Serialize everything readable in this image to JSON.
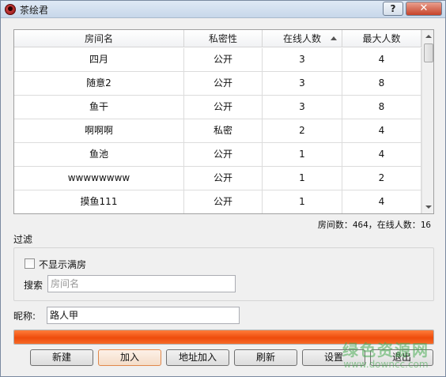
{
  "window": {
    "title": "茶绘君",
    "help_label": "?",
    "close_label": "✕"
  },
  "table": {
    "columns": [
      "房间名",
      "私密性",
      "在线人数",
      "最大人数"
    ],
    "sorted_column": "在线人数",
    "sort_direction": "ascending",
    "rows": [
      [
        "四月",
        "公开",
        "3",
        "4"
      ],
      [
        "随意2",
        "公开",
        "3",
        "8"
      ],
      [
        "鱼干",
        "公开",
        "3",
        "8"
      ],
      [
        "啊啊啊",
        "私密",
        "2",
        "4"
      ],
      [
        "鱼池",
        "公开",
        "1",
        "4"
      ],
      [
        "wwwwwwww",
        "公开",
        "1",
        "2"
      ],
      [
        "摸鱼111",
        "公开",
        "1",
        "4"
      ]
    ]
  },
  "stats": {
    "text": "房间数：464，在线人数：16"
  },
  "filter": {
    "label": "过滤",
    "hide_full_label": "不显示满房",
    "hide_full_checked": false,
    "search_label": "搜索",
    "search_placeholder": "房间名",
    "search_value": ""
  },
  "nickname": {
    "label": "昵称:",
    "value": "路人甲"
  },
  "progress": {
    "fraction": 1.0,
    "color": "#f05a1a"
  },
  "buttons": {
    "new": "新建",
    "join": "加入",
    "address_join": "地址加入",
    "refresh": "刷新",
    "settings": "设置",
    "exit": "退出"
  },
  "watermark": {
    "line1": "绿色资源网",
    "line2": "www.downcc.com"
  },
  "icons": {
    "app": "red-ladybug-icon",
    "help": "question-mark-icon",
    "close": "close-x-icon",
    "sort": "sort-up-arrow-icon"
  }
}
